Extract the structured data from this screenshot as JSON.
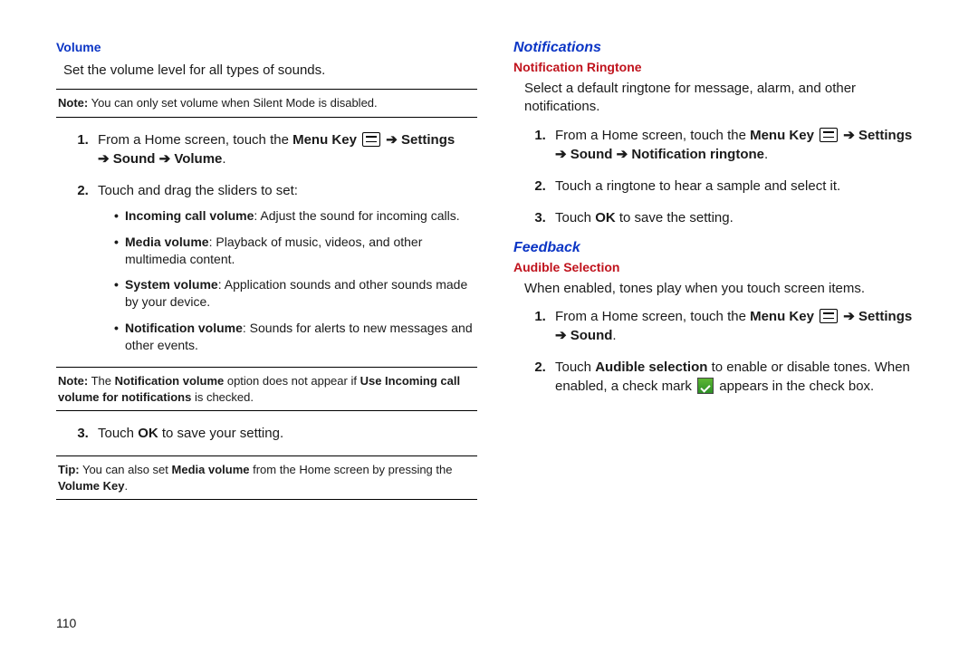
{
  "pageNumber": "110",
  "left": {
    "h_volume": "Volume",
    "intro": "Set the volume level for all types of sounds.",
    "note1_prefix": "Note:",
    "note1_body": " You can only set volume when Silent Mode is disabled.",
    "step1_a": "From a Home screen, touch the ",
    "step1_menu": "Menu Key",
    "step1_settings": "Settings",
    "step1_sound": "Sound",
    "step1_volume": "Volume",
    "step2": "Touch and drag the sliders to set:",
    "b1_t": "Incoming call volume",
    "b1_r": ": Adjust the sound for incoming calls.",
    "b2_t": "Media volume",
    "b2_r": ": Playback of music, videos, and other multimedia content.",
    "b3_t": "System volume",
    "b3_r": ": Application sounds and other sounds made by your device.",
    "b4_t": "Notification volume",
    "b4_r": ": Sounds for alerts to new messages and other events.",
    "note2_prefix": "Note:",
    "note2_a": " The ",
    "note2_b": "Notification volume",
    "note2_c": " option does not appear if ",
    "note2_d": "Use Incoming call volume for notifications",
    "note2_e": " is checked.",
    "step3_a": "Touch ",
    "step3_ok": "OK",
    "step3_b": " to save your setting.",
    "tip_prefix": "Tip:",
    "tip_a": " You can also set ",
    "tip_b": "Media volume",
    "tip_c": " from the Home screen by pressing the ",
    "tip_d": "Volume Key",
    "tip_e": "."
  },
  "right": {
    "h_notifications": "Notifications",
    "h_nr": "Notification Ringtone",
    "nr_intro": "Select a default ringtone for message, alarm, and other notifications.",
    "nr_s1_a": "From a Home screen, touch the ",
    "nr_s1_menu": "Menu Key",
    "nr_s1_settings": "Settings",
    "nr_s1_sound": "Sound",
    "nr_s1_dest": "Notification ringtone",
    "nr_s2": "Touch a ringtone to hear a sample and select it.",
    "nr_s3_a": "Touch ",
    "nr_s3_ok": "OK",
    "nr_s3_b": " to save the setting.",
    "h_feedback": "Feedback",
    "h_as": "Audible Selection",
    "as_intro": "When enabled, tones play when you touch screen items.",
    "as_s1_a": "From a Home screen, touch the ",
    "as_s1_menu": "Menu Key",
    "as_s1_settings": "Settings",
    "as_s1_sound": "Sound",
    "as_s2_a": "Touch ",
    "as_s2_b": "Audible selection",
    "as_s2_c": " to enable or disable tones. When enabled, a check mark ",
    "as_s2_d": " appears in the check box."
  },
  "glyphs": {
    "arrow": "➔"
  }
}
